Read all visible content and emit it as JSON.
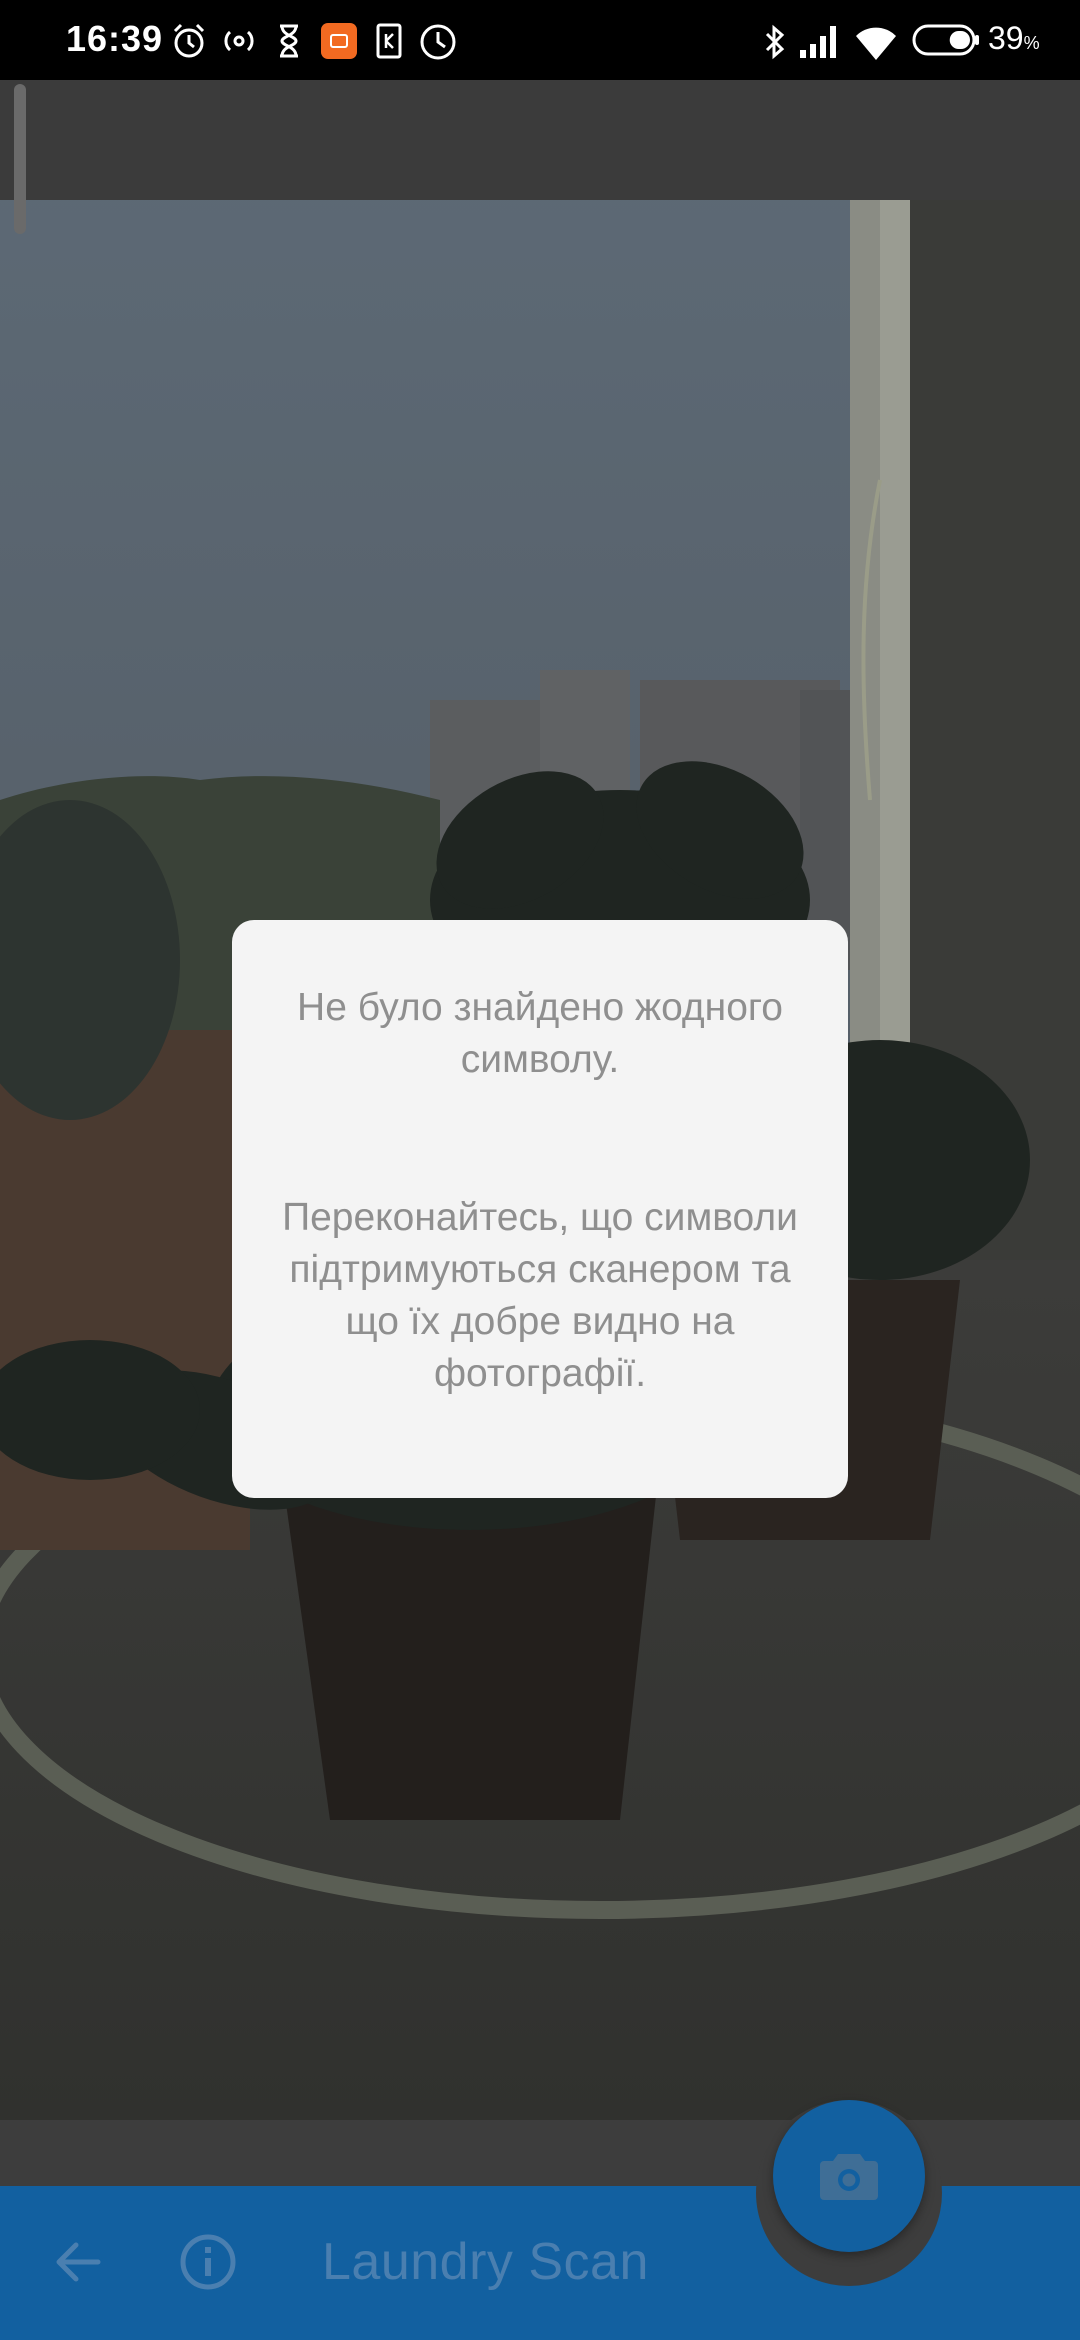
{
  "status_bar": {
    "time": "16:39",
    "battery_percent": "39",
    "battery_unit": "%",
    "battery_level": 0.39,
    "left_icons": [
      "alarm-icon",
      "hotspot-icon",
      "hourglass-icon",
      "mi-app-icon",
      "sim-icon",
      "clock-icon"
    ],
    "right_icons": [
      "bluetooth-icon",
      "signal-icon",
      "wifi-icon",
      "battery-icon"
    ]
  },
  "dialog": {
    "title": "Не було знайдено жодного символу.",
    "message": "Переконайтесь, що символи підтримуються сканером та що їх добре видно на фотографії."
  },
  "app_bar": {
    "title": "Laundry Scan",
    "back_icon": "arrow-back-icon",
    "info_icon": "info-icon",
    "camera_icon": "camera-icon"
  },
  "colors": {
    "app_bar": "#1260a0",
    "dialog_bg": "#f4f4f4",
    "dialog_text": "#8f8f8f"
  }
}
